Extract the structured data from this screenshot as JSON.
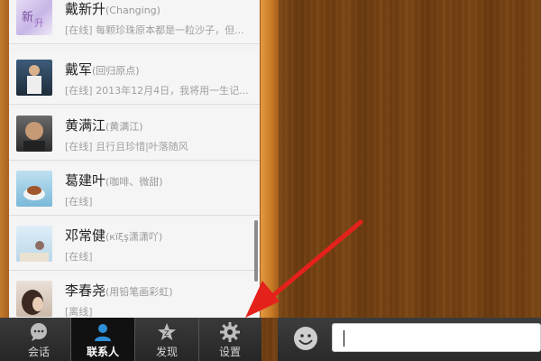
{
  "contacts": [
    {
      "name": "戴新升",
      "nick": "(Changing)",
      "status": "[在线] 每颗珍珠原本都是一粒沙子，但..."
    },
    {
      "name": "戴军",
      "nick": "(回归原点)",
      "status": "[在线] 2013年12月4日，我将用一生记..."
    },
    {
      "name": "黄满江",
      "nick": "(黄满江)",
      "status": "[在线] 且行且珍惜|叶落随风"
    },
    {
      "name": "葛建叶",
      "nick": "(咖啡、微甜)",
      "status": "[在线]"
    },
    {
      "name": "邓常健",
      "nick": "(кïξş潇潇吖)",
      "status": "[在线]"
    },
    {
      "name": "李春尧",
      "nick": "(用铅笔画彩虹)",
      "status": "[离线]"
    }
  ],
  "nav": {
    "chat_label": "会话",
    "contacts_label": "联系人",
    "discover_label": "发现",
    "settings_label": "设置",
    "active": "contacts"
  },
  "chat_input": {
    "value": ""
  },
  "icons": {
    "chat": "chat-bubble-icon",
    "contacts": "person-icon",
    "discover": "star-icon",
    "settings": "gear-icon",
    "emoji": "smiley-icon"
  },
  "colors": {
    "arrow": "#e5211b",
    "nav_active": "#111111",
    "wood": "#744213"
  }
}
